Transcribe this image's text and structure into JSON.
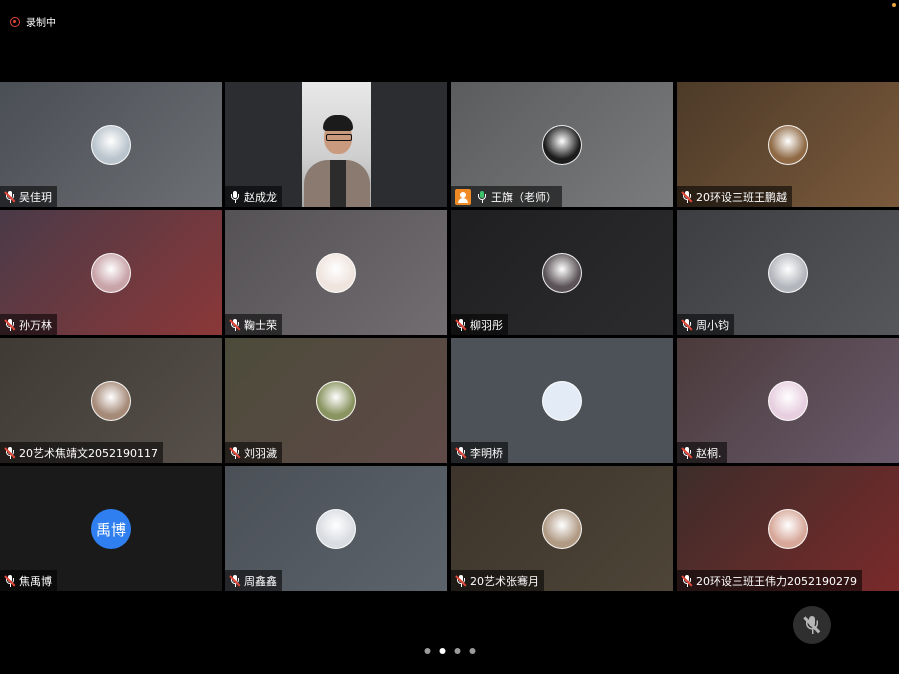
{
  "recording": {
    "label": "录制中"
  },
  "participants": [
    {
      "name": "吴佳玥",
      "mic": "muted",
      "bg": [
        "#4a4e55",
        "#6c6f73"
      ],
      "avatar_color": "#b9c4cc"
    },
    {
      "name": "赵成龙",
      "mic": "on-white",
      "bg": [
        "#2b2d30",
        "#2b2d30"
      ],
      "video": true
    },
    {
      "name": "王旗（老师）",
      "mic": "on",
      "host": true,
      "highlight": true,
      "bg": [
        "#5a5c5e",
        "#7a7b7c"
      ],
      "avatar_color": "#1c1c1c"
    },
    {
      "name": "20环设三班王鹏越",
      "mic": "muted",
      "bg": [
        "#4c3a28",
        "#7b5a3c"
      ],
      "avatar_color": "#8f6a45"
    },
    {
      "name": "孙万林",
      "mic": "muted",
      "bg": [
        "#4a3a48",
        "#8b3838"
      ],
      "avatar_color": "#c8a3a8"
    },
    {
      "name": "鞠士荣",
      "mic": "muted",
      "bg": [
        "#555256",
        "#716d70"
      ],
      "avatar_color": "#efe4de"
    },
    {
      "name": "柳羽彤",
      "mic": "muted",
      "bg": [
        "#1f1f21",
        "#2c2c2e"
      ],
      "avatar_color": "#5a5256"
    },
    {
      "name": "周小钧",
      "mic": "muted",
      "bg": [
        "#3c3e42",
        "#55575b"
      ],
      "avatar_color": "#b3b7bd"
    },
    {
      "name": "20艺术焦靖文2052190117",
      "mic": "muted",
      "bg": [
        "#3f3a34",
        "#57504a"
      ],
      "avatar_color": "#a58a78"
    },
    {
      "name": "刘羽濊",
      "mic": "muted",
      "bg": [
        "#4c4b3a",
        "#5f4a48"
      ],
      "avatar_color": "#8a9460"
    },
    {
      "name": "李明桥",
      "mic": "muted",
      "bg": [
        "#4c5258",
        "#4c5258"
      ],
      "avatar_color": "#e3ecf6"
    },
    {
      "name": "赵桐.",
      "mic": "muted",
      "bg": [
        "#4a3a3a",
        "#6a5a6c"
      ],
      "avatar_color": "#e7cfe0"
    },
    {
      "name": "焦禹博",
      "mic": "muted",
      "bg": [
        "#1a1a1a",
        "#1a1a1a"
      ],
      "initials": "禹博"
    },
    {
      "name": "周鑫鑫",
      "mic": "muted",
      "bg": [
        "#4a5056",
        "#5d636b"
      ],
      "avatar_color": "#d9dde2"
    },
    {
      "name": "20艺术张骞月",
      "mic": "muted",
      "bg": [
        "#3d342b",
        "#4e4538"
      ],
      "avatar_color": "#b09a84"
    },
    {
      "name": "20环设三班王伟力2052190279",
      "mic": "muted",
      "bg": [
        "#3c2d2a",
        "#7a2a2a"
      ],
      "avatar_color": "#d7a89a"
    }
  ],
  "pagination": {
    "pages": 4,
    "active": 1
  }
}
